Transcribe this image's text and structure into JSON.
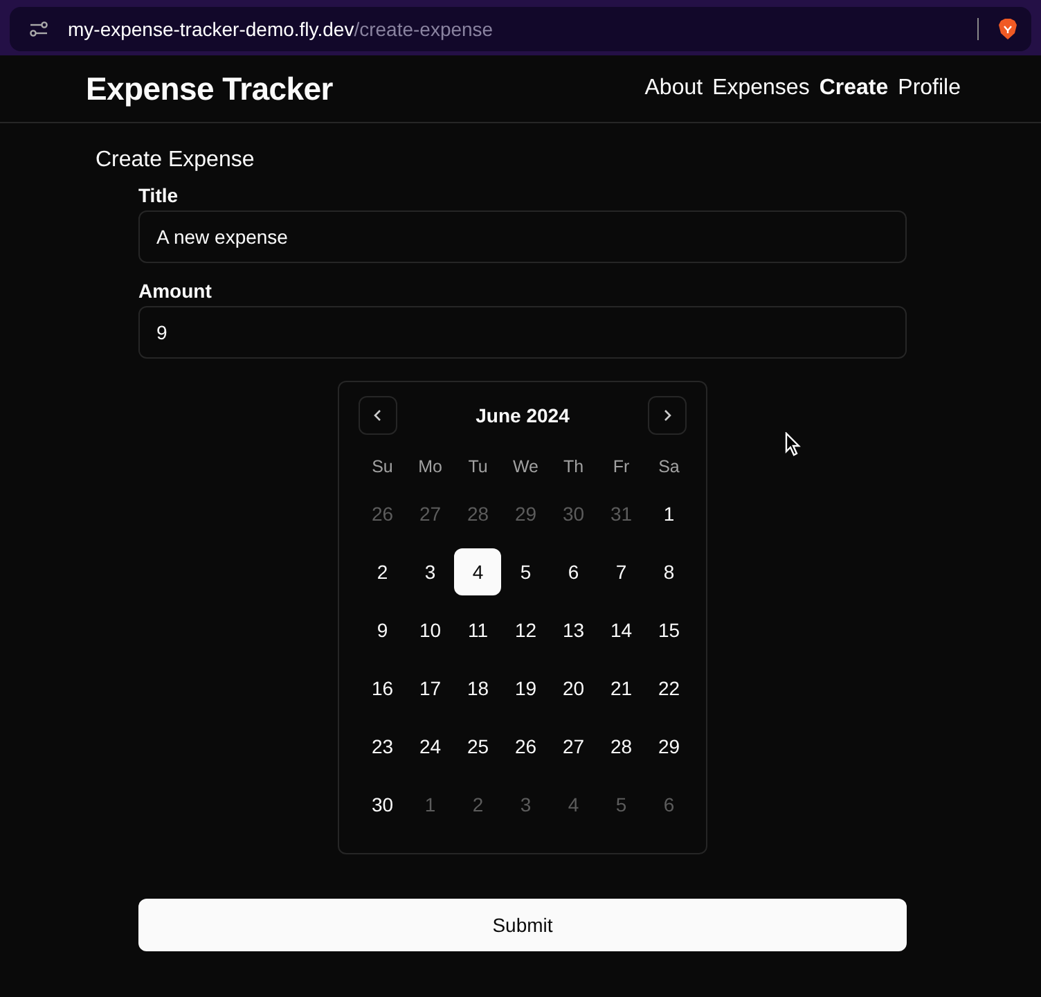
{
  "browser": {
    "url_host": "my-expense-tracker-demo.fly.dev",
    "url_path": "/create-expense"
  },
  "header": {
    "title": "Expense Tracker",
    "nav": [
      {
        "label": "About",
        "selected": false
      },
      {
        "label": "Expenses",
        "selected": false
      },
      {
        "label": "Create",
        "selected": true
      },
      {
        "label": "Profile",
        "selected": false
      }
    ]
  },
  "form": {
    "heading": "Create Expense",
    "fields": [
      {
        "label": "Title",
        "value": "A new expense"
      },
      {
        "label": "Amount",
        "value": "9"
      }
    ],
    "calendar": {
      "month": "June 2024",
      "weekdays": [
        "Su",
        "Mo",
        "Tu",
        "We",
        "Th",
        "Fr",
        "Sa"
      ],
      "weeks": [
        [
          {
            "day": "26",
            "outside": true,
            "selected": false
          },
          {
            "day": "27",
            "outside": true,
            "selected": false
          },
          {
            "day": "28",
            "outside": true,
            "selected": false
          },
          {
            "day": "29",
            "outside": true,
            "selected": false
          },
          {
            "day": "30",
            "outside": true,
            "selected": false
          },
          {
            "day": "31",
            "outside": true,
            "selected": false
          },
          {
            "day": "1",
            "outside": false,
            "selected": false
          }
        ],
        [
          {
            "day": "2",
            "outside": false,
            "selected": false
          },
          {
            "day": "3",
            "outside": false,
            "selected": false
          },
          {
            "day": "4",
            "outside": false,
            "selected": true
          },
          {
            "day": "5",
            "outside": false,
            "selected": false
          },
          {
            "day": "6",
            "outside": false,
            "selected": false
          },
          {
            "day": "7",
            "outside": false,
            "selected": false
          },
          {
            "day": "8",
            "outside": false,
            "selected": false
          }
        ],
        [
          {
            "day": "9",
            "outside": false,
            "selected": false
          },
          {
            "day": "10",
            "outside": false,
            "selected": false
          },
          {
            "day": "11",
            "outside": false,
            "selected": false
          },
          {
            "day": "12",
            "outside": false,
            "selected": false
          },
          {
            "day": "13",
            "outside": false,
            "selected": false
          },
          {
            "day": "14",
            "outside": false,
            "selected": false
          },
          {
            "day": "15",
            "outside": false,
            "selected": false
          }
        ],
        [
          {
            "day": "16",
            "outside": false,
            "selected": false
          },
          {
            "day": "17",
            "outside": false,
            "selected": false
          },
          {
            "day": "18",
            "outside": false,
            "selected": false
          },
          {
            "day": "19",
            "outside": false,
            "selected": false
          },
          {
            "day": "20",
            "outside": false,
            "selected": false
          },
          {
            "day": "21",
            "outside": false,
            "selected": false
          },
          {
            "day": "22",
            "outside": false,
            "selected": false
          }
        ],
        [
          {
            "day": "23",
            "outside": false,
            "selected": false
          },
          {
            "day": "24",
            "outside": false,
            "selected": false
          },
          {
            "day": "25",
            "outside": false,
            "selected": false
          },
          {
            "day": "26",
            "outside": false,
            "selected": false
          },
          {
            "day": "27",
            "outside": false,
            "selected": false
          },
          {
            "day": "28",
            "outside": false,
            "selected": false
          },
          {
            "day": "29",
            "outside": false,
            "selected": false
          }
        ],
        [
          {
            "day": "30",
            "outside": false,
            "selected": false
          },
          {
            "day": "1",
            "outside": true,
            "selected": false
          },
          {
            "day": "2",
            "outside": true,
            "selected": false
          },
          {
            "day": "3",
            "outside": true,
            "selected": false
          },
          {
            "day": "4",
            "outside": true,
            "selected": false
          },
          {
            "day": "5",
            "outside": true,
            "selected": false
          },
          {
            "day": "6",
            "outside": true,
            "selected": false
          }
        ]
      ]
    },
    "submit": "Submit"
  }
}
